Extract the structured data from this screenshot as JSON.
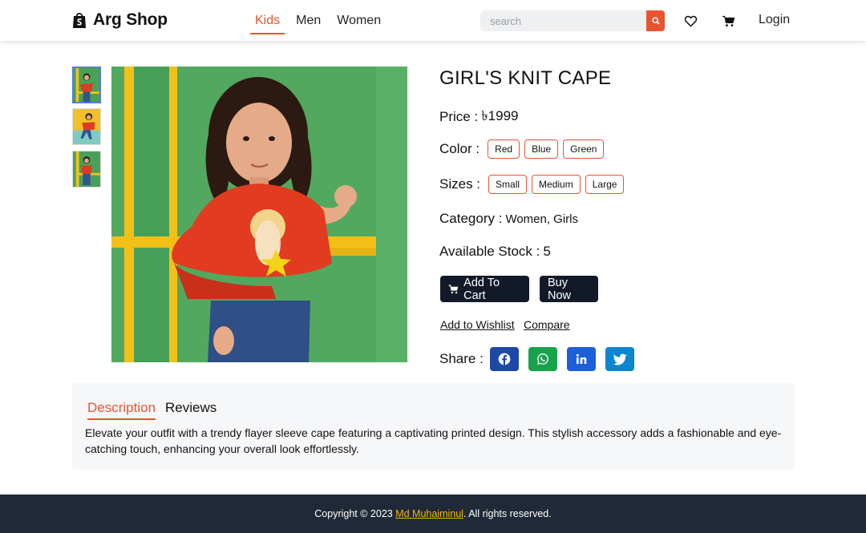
{
  "header": {
    "brand": "Arg Shop",
    "nav": [
      {
        "label": "Kids",
        "active": true
      },
      {
        "label": "Men",
        "active": false
      },
      {
        "label": "Women",
        "active": false
      }
    ],
    "search_placeholder": "search",
    "login": "Login"
  },
  "gallery": {
    "thumbnails": [
      "thumbnail-1",
      "thumbnail-2",
      "thumbnail-3"
    ],
    "selected": 0
  },
  "product": {
    "title": "GIRL'S KNIT CAPE",
    "price_label": "Price :",
    "price": "৳1999",
    "color_label": "Color :",
    "colors": [
      "Red",
      "Blue",
      "Green"
    ],
    "sizes_label": "Sizes :",
    "sizes": [
      "Small",
      "Medium",
      "Large"
    ],
    "category_label": "Category :",
    "category": "Women, Girls",
    "stock_label": "Available Stock :",
    "stock": "5",
    "add_to_cart": "Add To Cart",
    "buy_now": "Buy Now",
    "add_to_wishlist": "Add to Wishlist",
    "compare": "Compare",
    "share_label": "Share :",
    "share": [
      {
        "icon": "facebook-icon",
        "color": "#1d48a8"
      },
      {
        "icon": "whatsapp-icon",
        "color": "#16a34a"
      },
      {
        "icon": "linkedin-icon",
        "color": "#1d5fd8"
      },
      {
        "icon": "twitter-icon",
        "color": "#0a86d0"
      }
    ]
  },
  "tabs": {
    "description": "Description",
    "reviews": "Reviews",
    "active": "Description"
  },
  "description": "Elevate your outfit with a trendy flayer sleeve cape featuring a captivating printed design. This stylish accessory adds a fashionable and eye-catching touch, enhancing your overall look effortlessly.",
  "footer": {
    "prefix": "Copyright © 2023 ",
    "author": "Md Muhaiminul",
    "suffix": ". All rights reserved."
  },
  "colors": {
    "accent": "#e8542f",
    "dark": "#121a2a",
    "footer_bg": "#1f2937",
    "footer_link": "#f2b705"
  }
}
